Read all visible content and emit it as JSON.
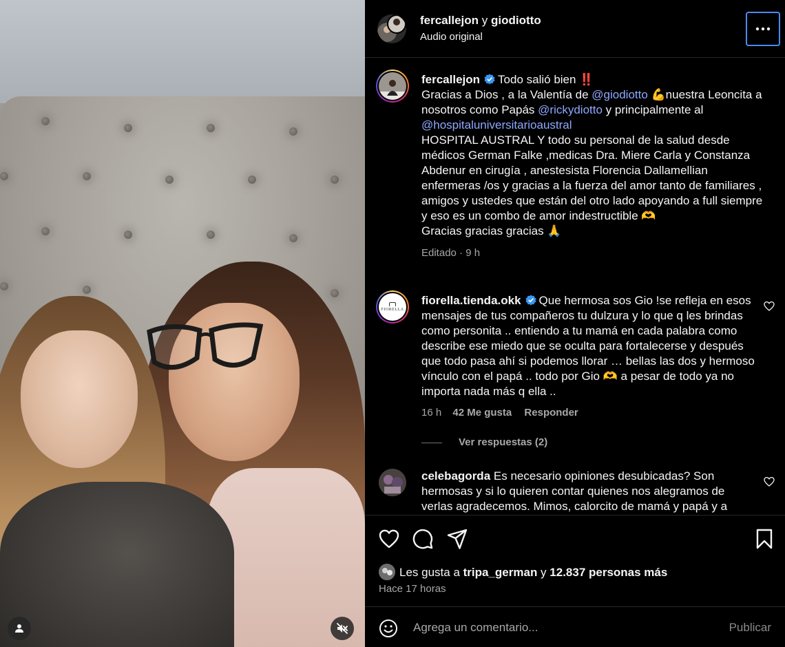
{
  "header": {
    "user1": "fercallejon",
    "joiner": "y",
    "user2": "giodiotto",
    "audio": "Audio original"
  },
  "caption": {
    "username": "fercallejon",
    "line1": "Todo salió bien ‼️",
    "l2a": "Gracias a Dios , a la Valentía de ",
    "m_gio": "@giodiotto",
    "l2b": " 💪nuestra Leoncita a nosotros como Papás ",
    "m_ricky": "@rickydiotto",
    "l2c": " y principalmente al ",
    "m_hosp": "@hospitaluniversitarioaustral",
    "body": "HOSPITAL AUSTRAL Y todo su personal de la salud desde médicos German Falke ,medicas Dra. Miere Carla y Constanza Abdenur en cirugía , anestesista Florencia Dallamellian enfermeras /os y gracias a la fuerza del amor tanto de familiares , amigos y ustedes que están del otro lado apoyando a full siempre y eso es un combo de amor indestructible 🫶",
    "thanks": "Gracias gracias gracias 🙏",
    "edited": "Editado",
    "dot": "·",
    "age": "9 h"
  },
  "comment1": {
    "username": "fiorella.tienda.okk",
    "avatar_text": "FIORELLA",
    "text": "Que hermosa sos Gio !se refleja en esos mensajes de tus compañeros tu dulzura y lo que q les brindas como personita .. entiendo a tu mamá en cada palabra como describe ese miedo que se oculta para fortalecerse y después que todo pasa ahí si podemos llorar … bellas las dos y hermoso vínculo con el papá .. todo por Gio 🫶 a pesar de todo ya no importa nada más q ella ..",
    "age": "16 h",
    "likes": "42 Me gusta",
    "reply": "Responder",
    "view_replies": "Ver respuestas (2)"
  },
  "comment2": {
    "username": "celebagorda",
    "text": "Es necesario opiniones desubicadas? Son hermosas y si lo quieren contar quienes nos alegramos de verlas agradecemos. Mimos, calorcito de mamá y papá y a"
  },
  "likes": {
    "prefix": "Les gusta a ",
    "user": "tripa_german",
    "mid": " y ",
    "count": "12.837 personas más"
  },
  "posted": "Hace 17 horas",
  "add_comment": {
    "placeholder": "Agrega un comentario...",
    "publish": "Publicar"
  },
  "colors": {
    "mention": "#8fa8ff",
    "focus_ring": "#4a8af4",
    "verified": "#3897f0"
  },
  "icons": [
    "heart-icon",
    "comment-icon",
    "share-icon",
    "bookmark-icon",
    "emoji-icon",
    "more-icon",
    "user-tag-icon",
    "mute-icon",
    "verified-icon"
  ]
}
